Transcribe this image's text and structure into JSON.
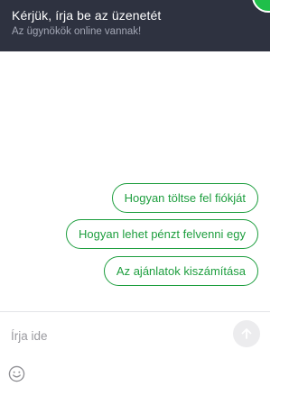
{
  "header": {
    "title": "Kérjük, írja be az üzenetét",
    "subtitle": "Az ügynökök online vannak!",
    "status_color": "#1fbf4a"
  },
  "quick_replies": [
    "Hogyan töltse fel fiókját",
    "Hogyan lehet pénzt felvenni egy",
    "Az ajánlatok kiszámítása"
  ],
  "composer": {
    "placeholder": "Írja ide",
    "send_icon": "arrow-up-icon",
    "emoji_icon": "smiley-icon"
  },
  "colors": {
    "header_bg": "#2e3240",
    "accent": "#1d9e3e"
  }
}
